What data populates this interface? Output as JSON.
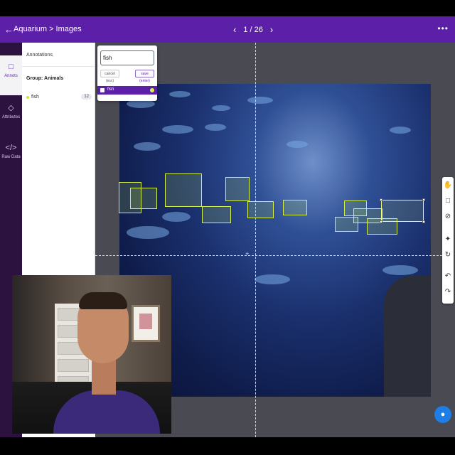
{
  "header": {
    "back_icon": "arrow-left-icon",
    "breadcrumb_root": "Aquarium",
    "breadcrumb_separator": ">",
    "breadcrumb_current": "Images",
    "pager_prev_icon": "chevron-left-icon",
    "pager_text": "1 / 26",
    "pager_next_icon": "chevron-right-icon",
    "more_icon": "dots-icon",
    "bar_color": "#5b1fa8"
  },
  "left_rail": {
    "items": [
      {
        "label": "Annots",
        "icon": "document-icon",
        "active": true
      },
      {
        "label": "Attributes",
        "icon": "tag-icon",
        "active": false
      },
      {
        "label": "Raw Data",
        "icon": "code-icon",
        "active": false
      }
    ]
  },
  "annotations_panel": {
    "title": "Annotations",
    "group_title": "Group: Animals",
    "items": [
      {
        "label": "fish",
        "count": "12",
        "color": "#c7e93a"
      }
    ]
  },
  "label_popup": {
    "input_value": "fish",
    "cancel_label": "cancel (esc)",
    "save_label": "save (enter)",
    "suggestion_label": "fish",
    "suggestion_color": "#d6f24a"
  },
  "toolbar": {
    "tools": [
      "hand-icon",
      "bounding-box-icon",
      "cancel-icon",
      "magic-wand-icon",
      "rotate-icon",
      "undo-icon",
      "redo-icon"
    ]
  },
  "chat": {
    "icon": "chat-bubble-icon",
    "color": "#1e7de6"
  },
  "webcam": {
    "description_icon": "webcam-overlay"
  }
}
